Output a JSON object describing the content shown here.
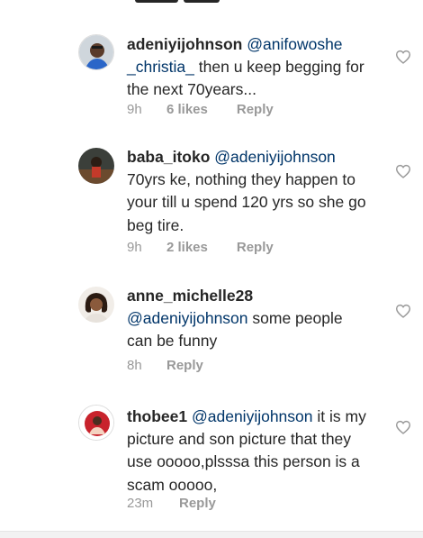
{
  "comments": [
    {
      "username": "adeniyijohnson",
      "mention": "@anifowoshe _christia_",
      "body": " then u keep begging for the next 70years...",
      "time": "9h",
      "likes": "6 likes",
      "reply": "Reply"
    },
    {
      "username": "baba_itoko",
      "mention": "@adeniyijohnson",
      "body": " 70yrs ke, nothing they happen to your till u spend 120 yrs  so she go beg tire.",
      "time": "9h",
      "likes": "2 likes",
      "reply": "Reply"
    },
    {
      "username": "anne_michelle28",
      "mention": "@adeniyijohnson",
      "body": " some people can be funny",
      "time": "8h",
      "likes": "",
      "reply": "Reply"
    },
    {
      "username": "thobee1",
      "mention": "@adeniyijohnson",
      "body": " it is my picture and son picture that they use ooooo,plsssa this person is a scam ooooo,",
      "time": "23m",
      "likes": "",
      "reply": "Reply"
    }
  ],
  "icons": {
    "like": "heart-outline-icon"
  },
  "colors": {
    "mention": "#003569",
    "meta": "#999999",
    "text": "#262626"
  }
}
